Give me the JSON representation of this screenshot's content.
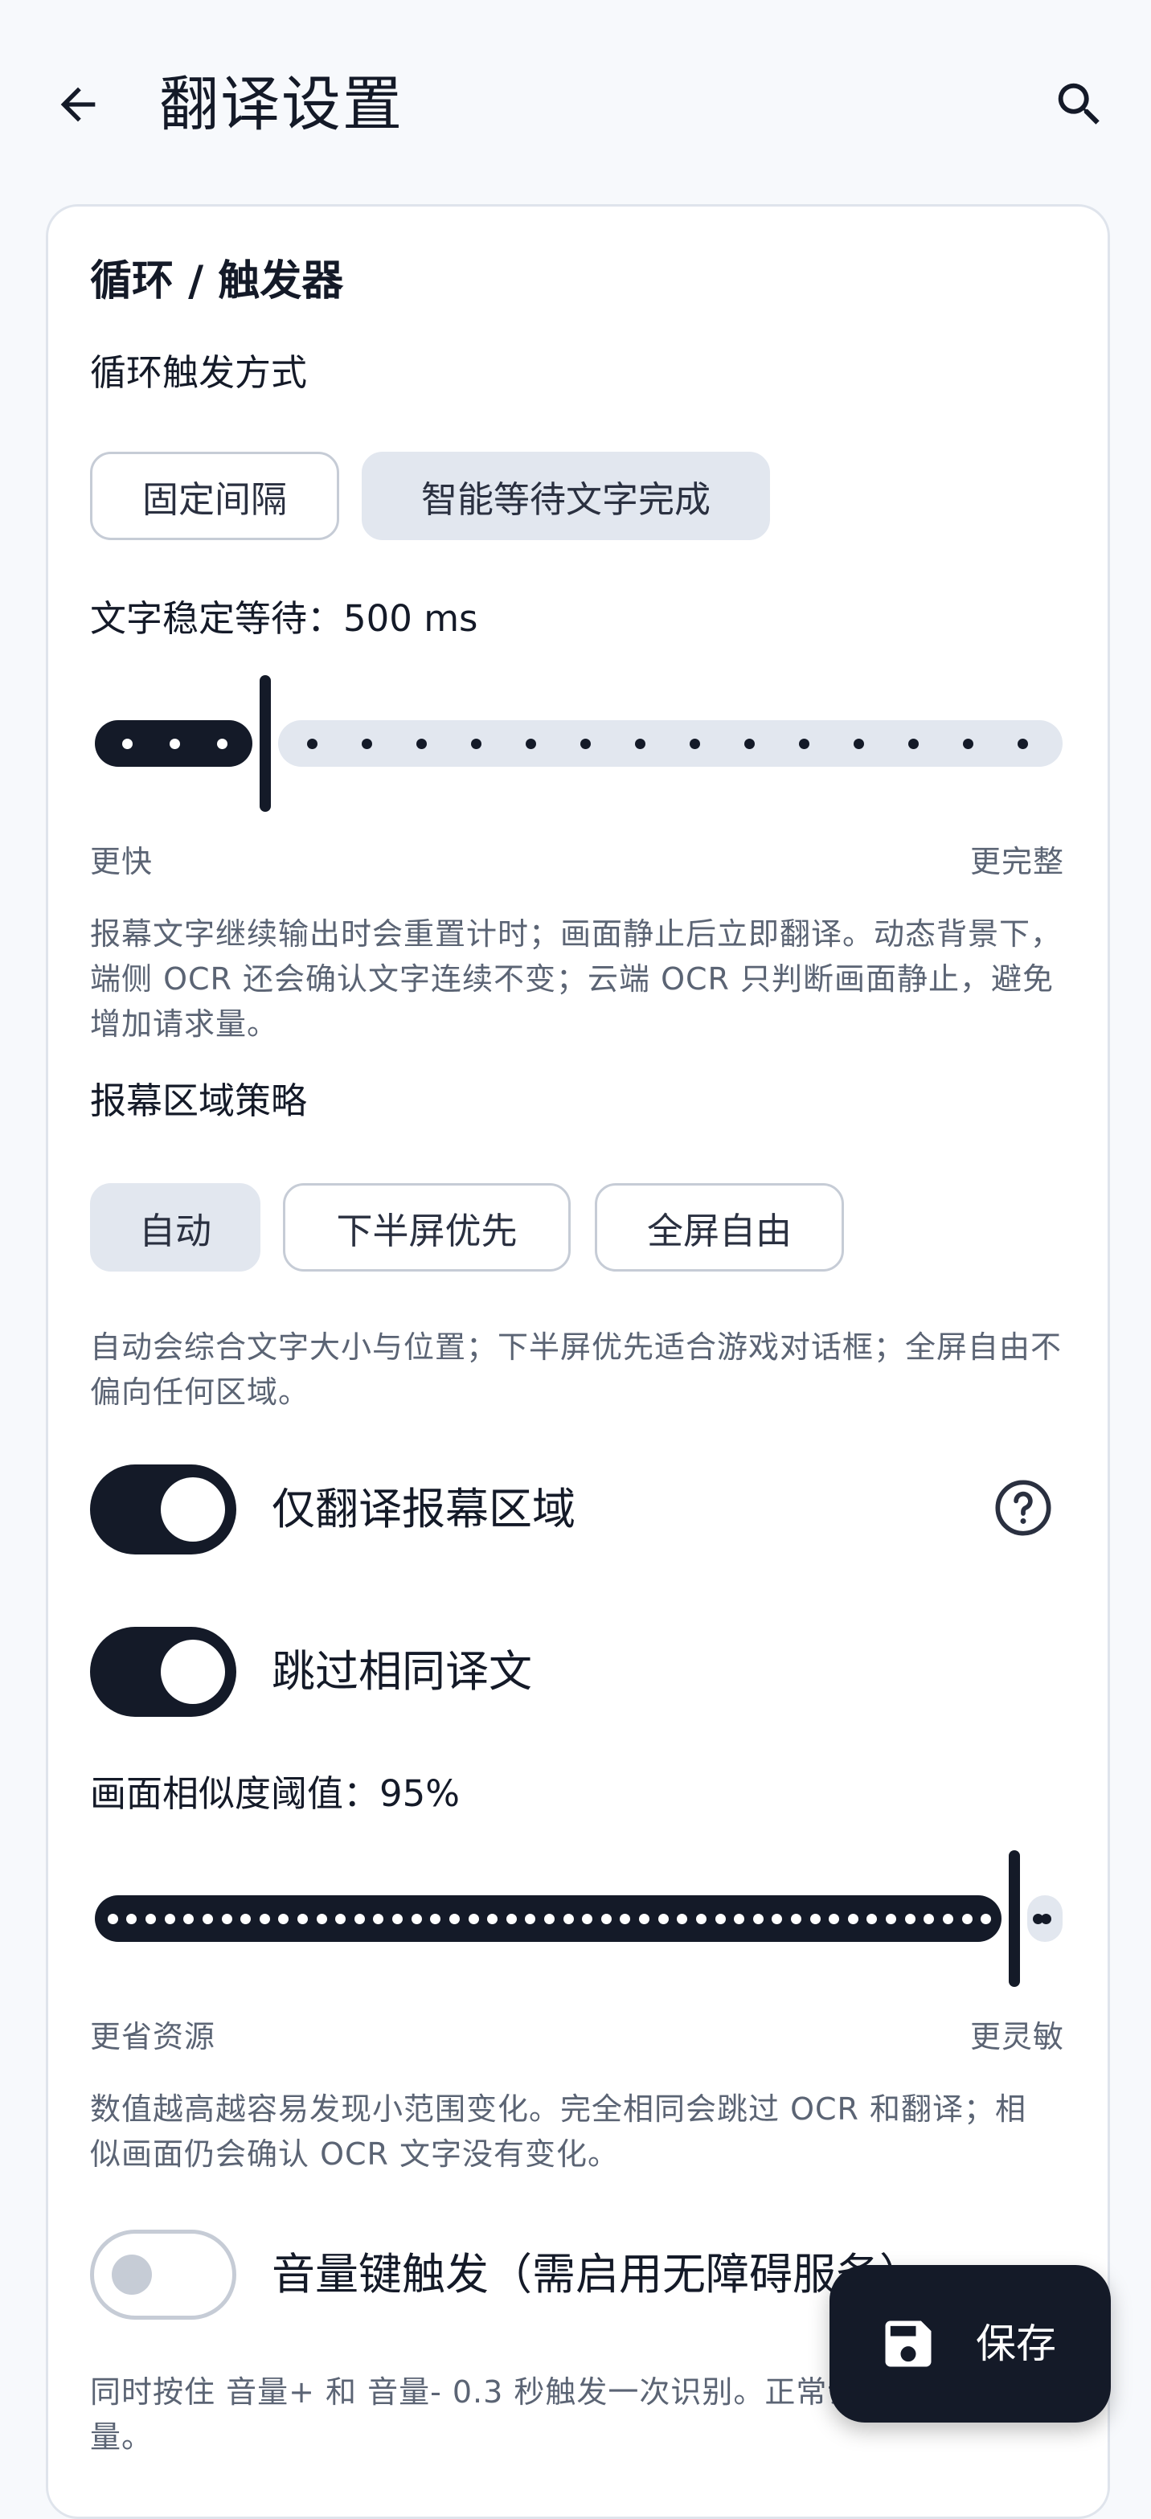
{
  "header": {
    "title": "翻译设置",
    "back_icon": "arrow-back-icon",
    "search_icon": "search-icon"
  },
  "section": {
    "title": "循环 / 触发器"
  },
  "loop_mode": {
    "label": "循环触发方式",
    "options": [
      "固定间隔",
      "智能等待文字完成"
    ],
    "selected": "智能等待文字完成"
  },
  "stable_wait": {
    "label": "文字稳定等待：500 ms",
    "value_ms": 500,
    "fraction": 0.18,
    "min_label": "更快",
    "max_label": "更完整",
    "description": "报幕文字继续输出时会重置计时；画面静止后立即翻译。动态背景下，端侧 OCR 还会确认文字连续不变；云端 OCR 只判断画面静止，避免增加请求量。"
  },
  "subtitle_strategy": {
    "label": "报幕区域策略",
    "options": [
      "自动",
      "下半屏优先",
      "全屏自由"
    ],
    "selected": "自动",
    "description": "自动会综合文字大小与位置；下半屏优先适合游戏对话框；全屏自由不偏向任何区域。"
  },
  "toggles": {
    "only_subtitle": {
      "label": "仅翻译报幕区域",
      "on": true,
      "help_icon": "help-circle-icon"
    },
    "skip_same": {
      "label": "跳过相同译文",
      "on": true
    },
    "volume_key": {
      "label": "音量键触发（需启用无障碍服务）",
      "on": false
    }
  },
  "similarity": {
    "label": "画面相似度阈值：95%",
    "value_percent": 95,
    "fraction": 0.95,
    "min_label": "更省资源",
    "max_label": "更灵敏",
    "description": "数值越高越容易发现小范围变化。完全相同会跳过 OCR 和翻译；相似画面仍会确认 OCR 文字没有变化。"
  },
  "volume_desc": "同时按住 音量+ 和 音量- 0.3 秒触发一次识别。正常调音量。",
  "fab": {
    "label": "保存",
    "icon": "save-icon"
  },
  "colors": {
    "accent": "#141a28",
    "track_inactive": "#e2e7ef",
    "background": "#f7f9fc"
  }
}
